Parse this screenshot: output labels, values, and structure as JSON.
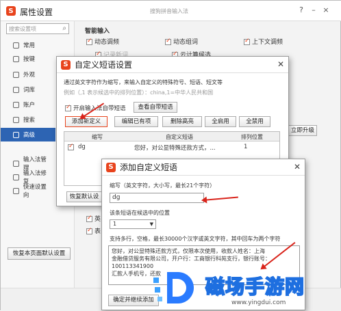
{
  "main": {
    "title": "属性设置",
    "subtitle": "搜狗拼音输入法",
    "controls": [
      "?",
      "–",
      "×"
    ],
    "search_placeholder": "搜索设置项",
    "nav": [
      "常用",
      "按键",
      "外观",
      "词库",
      "账户",
      "搜索",
      "高级"
    ],
    "nav_bottom": [
      "输入法管理",
      "输入法修复",
      "快速设置向"
    ],
    "section_title": "智能输入",
    "options": [
      {
        "label": "动态调频",
        "checked": true
      },
      {
        "label": "动态组词",
        "checked": true
      },
      {
        "label": "上下文调频",
        "checked": true
      },
      {
        "label": "记录新词",
        "checked": true
      },
      {
        "label": "云计算候选",
        "checked": true
      }
    ],
    "upgrade_button": "立即升级",
    "restore_page_button": "恢复本页面默认设置",
    "partial_labels": [
      "英",
      "表"
    ]
  },
  "dialog1": {
    "title": "自定义短语设置",
    "desc1": "通过英文字符作为缩写，来输入自定义的特殊符号、短语、短文等",
    "desc2": "例如（,1 表示候选中的排列位置）：china,1=中华人民共和国",
    "enable_label": "开启输入法自带短语",
    "enable_checked": true,
    "view_builtin": "查看自带短语",
    "buttons": [
      "添加新定义",
      "编辑已有项",
      "删除高亮",
      "全启用",
      "全禁用"
    ],
    "columns": [
      "缩写",
      "自定义短语",
      "排列位置"
    ],
    "rows": [
      {
        "abbr": "dg",
        "phrase": "您好，对公显特殊还款方式，...",
        "pos": "1",
        "checked": true
      }
    ],
    "restore_default": "恢复默认设"
  },
  "dialog2": {
    "title": "添加自定义短语",
    "abbr_label": "缩写（英文字符，大小写，最长21个字符）",
    "abbr_value": "dg",
    "pos_label": "该条短语在候选中的位置",
    "pos_value": "1",
    "content_label": "支持多行，空格，最长30000个汉字或英文字符，其中回车为两个字符",
    "content_lines": [
      "您好，对公显特殊还款方式，仅限本次使用，收款人姓名：上海",
      "金融借贷服务有限公司，开户行：工商银行科苑支行，银行账号：",
      "100113341900",
      "汇款人手机号，还款"
    ],
    "confirm_button": "确定并继续添加"
  },
  "watermark": {
    "text": "磁场手游网",
    "url": "www.yingdui.com"
  },
  "colors": {
    "accent": "#e8431c",
    "arrow": "#d9241b",
    "selected_nav": "#2d64b3"
  }
}
